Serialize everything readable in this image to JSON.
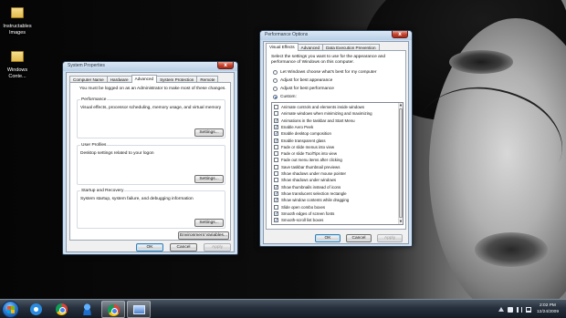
{
  "desktop": {
    "icons": [
      {
        "label_line1": "Instructables",
        "label_line2": "Images"
      },
      {
        "label_line1": "Windows",
        "label_line2": "Conte..."
      }
    ]
  },
  "system_properties": {
    "title": "System Properties",
    "close_glyph": "x",
    "tabs": [
      "Computer Name",
      "Hardware",
      "Advanced",
      "System Protection",
      "Remote"
    ],
    "active_tab": "Advanced",
    "admin_notice": "You must be logged on as an Administrator to make most of these changes.",
    "performance": {
      "title": "Performance",
      "description": "Visual effects, processor scheduling, memory usage, and virtual memory",
      "settings_label": "Settings..."
    },
    "user_profiles": {
      "title": "User Profiles",
      "description": "Desktop settings related to your logon",
      "settings_label": "Settings..."
    },
    "startup_recovery": {
      "title": "Startup and Recovery",
      "description": "System startup, system failure, and debugging information",
      "settings_label": "Settings..."
    },
    "env_button": "Environment Variables...",
    "ok": "OK",
    "cancel": "Cancel",
    "apply": "Apply"
  },
  "performance_options": {
    "title": "Performance Options",
    "close_glyph": "x",
    "tabs": [
      "Visual Effects",
      "Advanced",
      "Data Execution Prevention"
    ],
    "active_tab": "Visual Effects",
    "intro_line1": "Select the settings you want to use for the appearance and",
    "intro_line2": "performance of Windows on this computer.",
    "radios": [
      {
        "label": "Let Windows choose what's best for my computer",
        "selected": false
      },
      {
        "label": "Adjust for best appearance",
        "selected": false
      },
      {
        "label": "Adjust for best performance",
        "selected": false
      },
      {
        "label": "Custom:",
        "selected": true
      }
    ],
    "check_glyph": "✓",
    "effects": [
      {
        "label": "Animate controls and elements inside windows",
        "checked": false
      },
      {
        "label": "Animate windows when minimizing and maximizing",
        "checked": false
      },
      {
        "label": "Animations in the taskbar and Start Menu",
        "checked": true
      },
      {
        "label": "Enable Aero Peek",
        "checked": true
      },
      {
        "label": "Enable desktop composition",
        "checked": true
      },
      {
        "label": "Enable transparent glass",
        "checked": true
      },
      {
        "label": "Fade or slide menus into view",
        "checked": false
      },
      {
        "label": "Fade or slide ToolTips into view",
        "checked": false
      },
      {
        "label": "Fade out menu items after clicking",
        "checked": false
      },
      {
        "label": "Save taskbar thumbnail previews",
        "checked": false
      },
      {
        "label": "Show shadows under mouse pointer",
        "checked": false
      },
      {
        "label": "Show shadows under windows",
        "checked": false
      },
      {
        "label": "Show thumbnails instead of icons",
        "checked": true
      },
      {
        "label": "Show translucent selection rectangle",
        "checked": true
      },
      {
        "label": "Show window contents while dragging",
        "checked": true
      },
      {
        "label": "Slide open combo boxes",
        "checked": false
      },
      {
        "label": "Smooth edges of screen fonts",
        "checked": true
      },
      {
        "label": "Smooth-scroll list boxes",
        "checked": true
      }
    ],
    "scroll_up_glyph": "▲",
    "scroll_down_glyph": "▼",
    "ok": "OK",
    "cancel": "Cancel",
    "apply": "Apply"
  },
  "taskbar": {
    "apps": [
      "internet-explorer",
      "chrome",
      "windows-live-messenger",
      "chrome",
      "system-properties"
    ],
    "clock": {
      "time": "2:02 PM",
      "date": "12/24/2009"
    }
  },
  "colors": {
    "glass": "#cfe0f1",
    "accent": "#2b6ec9",
    "close": "#c5412b"
  }
}
